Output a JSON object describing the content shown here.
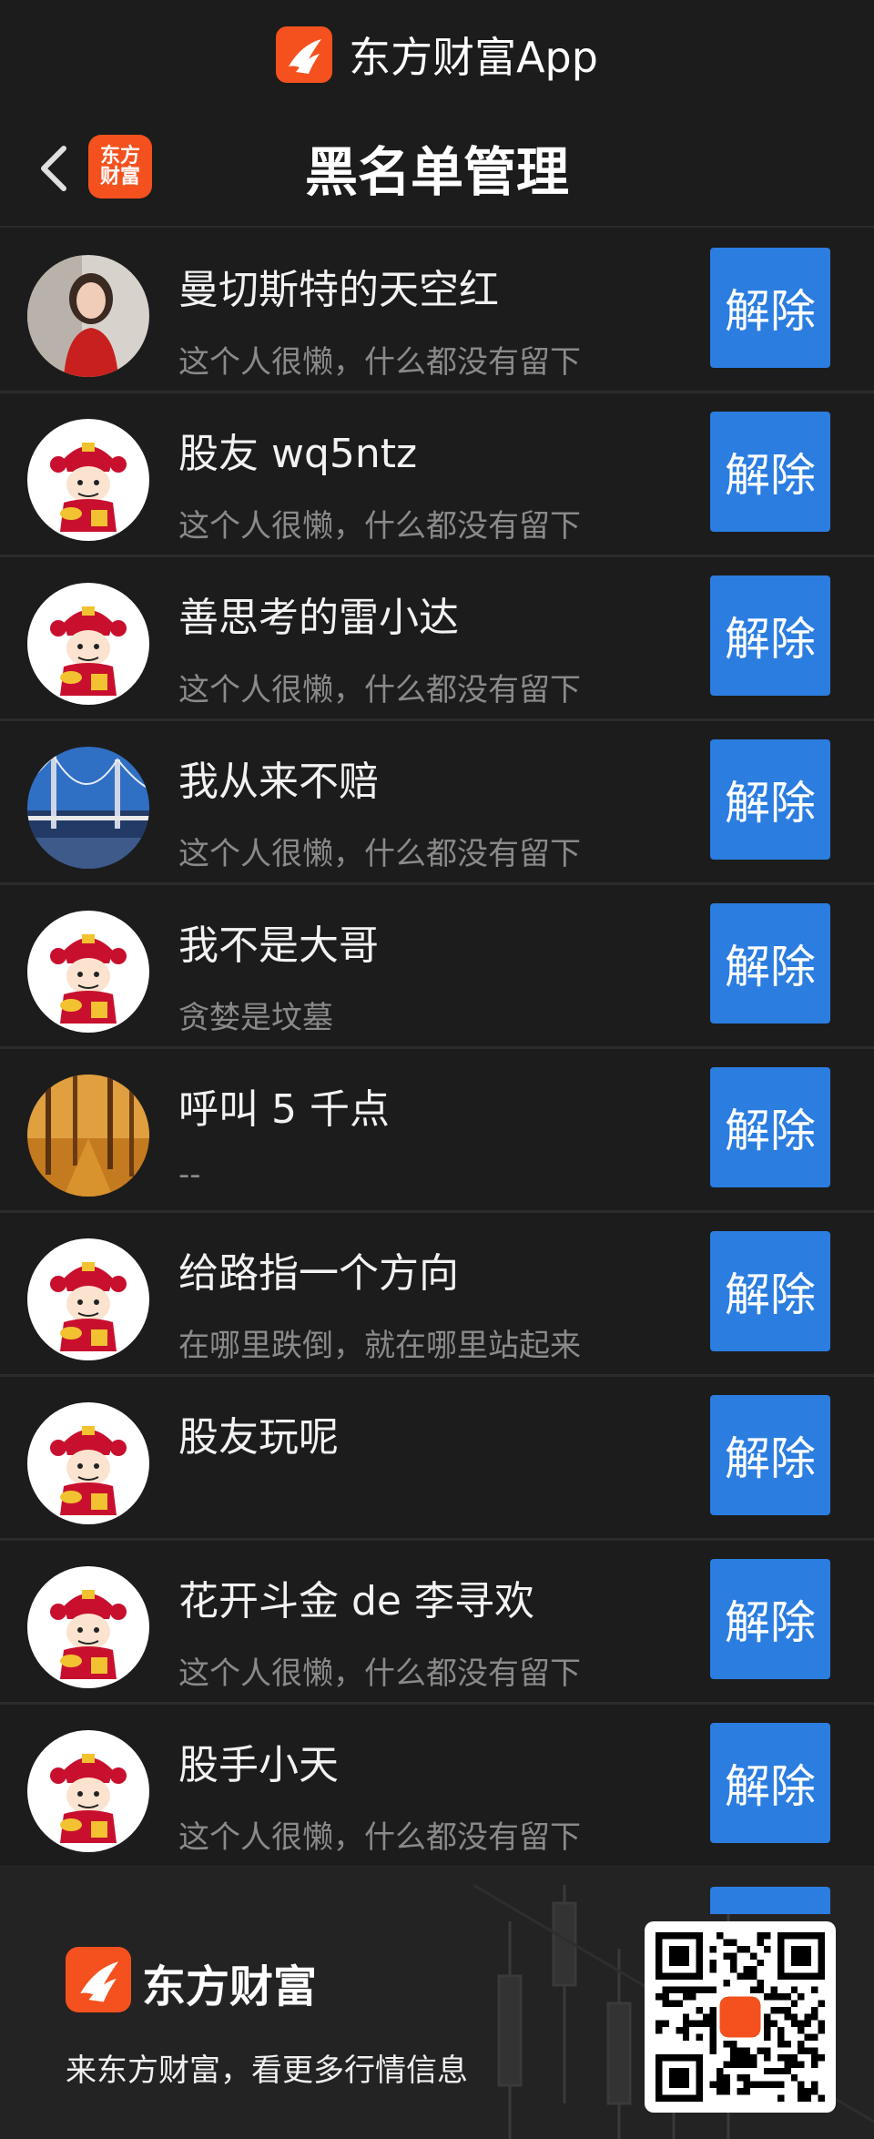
{
  "topbar": {
    "app_title": "东方财富App",
    "logo_icon": "eastmoney-logo-icon"
  },
  "navbar": {
    "title": "黑名单管理",
    "back_icon": "chevron-left-icon",
    "brand_line1": "东方",
    "brand_line2": "财富"
  },
  "unblock_label": "解除",
  "users": [
    {
      "name": "曼切斯特的天空红",
      "signature": "这个人很懒，什么都没有留下",
      "avatar": "photo-woman"
    },
    {
      "name": "股友 wq5ntz",
      "signature": "这个人很懒，什么都没有留下",
      "avatar": "cartoon-god-of-wealth"
    },
    {
      "name": "善思考的雷小达",
      "signature": "这个人很懒，什么都没有留下",
      "avatar": "cartoon-god-of-wealth"
    },
    {
      "name": "我从来不赔",
      "signature": "这个人很懒，什么都没有留下",
      "avatar": "photo-bridge"
    },
    {
      "name": "我不是大哥",
      "signature": "贪婪是坟墓",
      "avatar": "cartoon-god-of-wealth"
    },
    {
      "name": "呼叫 5 千点",
      "signature": "--",
      "avatar": "photo-autumn-forest"
    },
    {
      "name": "给路指一个方向",
      "signature": "在哪里跌倒，就在哪里站起来",
      "avatar": "cartoon-god-of-wealth"
    },
    {
      "name": "股友玩呢",
      "signature": "",
      "avatar": "cartoon-god-of-wealth"
    },
    {
      "name": "花开斗金 de 李寻欢",
      "signature": "这个人很懒，什么都没有留下",
      "avatar": "cartoon-god-of-wealth"
    },
    {
      "name": "股手小天",
      "signature": "这个人很懒，什么都没有留下",
      "avatar": "cartoon-god-of-wealth"
    }
  ],
  "footer": {
    "brand": "东方财富",
    "slogan": "来东方财富，看更多行情信息",
    "qr_icon": "qr-code-icon"
  },
  "colors": {
    "background": "#1c1c1c",
    "accent_button": "#2b7de0",
    "brand_orange": "#f4511e"
  }
}
